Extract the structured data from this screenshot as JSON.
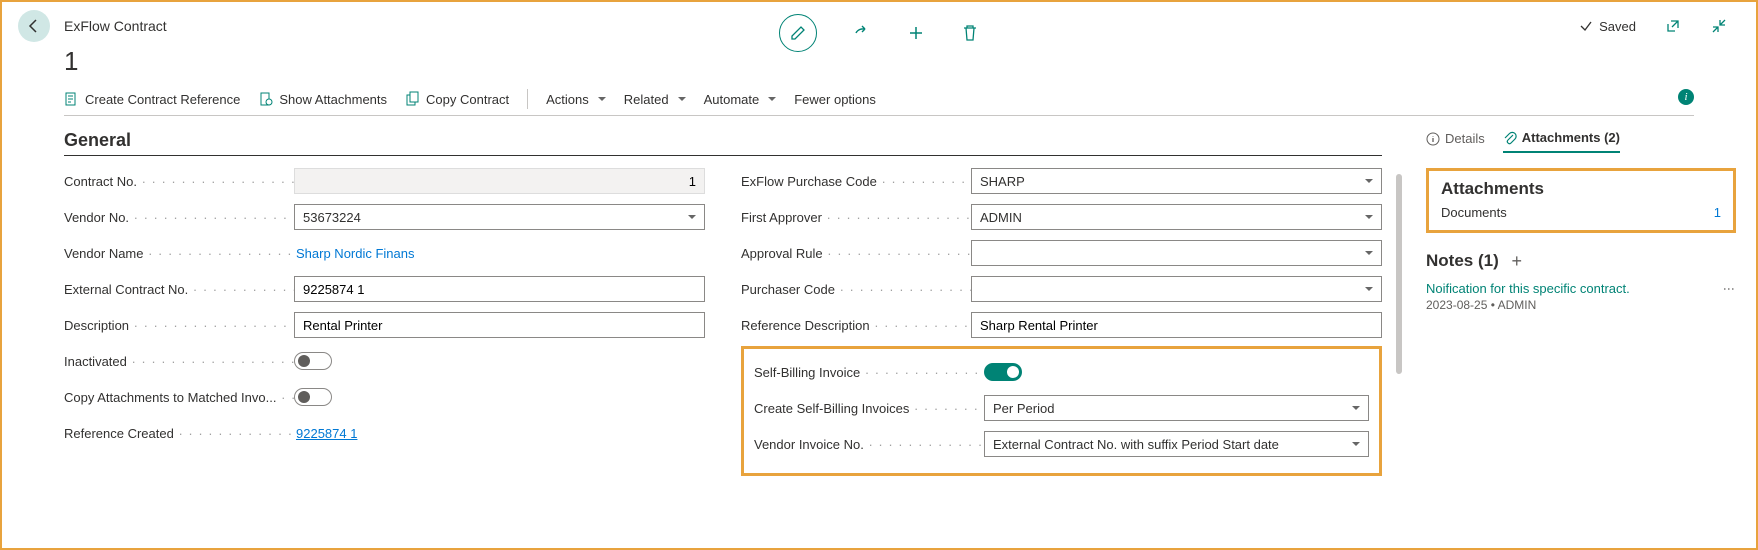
{
  "header": {
    "page_type": "ExFlow Contract",
    "entity_id": "1",
    "saved": "Saved"
  },
  "toolbar": {
    "create_ref": "Create Contract Reference",
    "show_attach": "Show Attachments",
    "copy_contract": "Copy Contract",
    "actions": "Actions",
    "related": "Related",
    "automate": "Automate",
    "fewer": "Fewer options"
  },
  "section": {
    "general": "General"
  },
  "fields": {
    "contract_no": {
      "label": "Contract No.",
      "value": "1"
    },
    "vendor_no": {
      "label": "Vendor No.",
      "value": "53673224"
    },
    "vendor_name": {
      "label": "Vendor Name",
      "value": "Sharp Nordic Finans"
    },
    "ext_contract_no": {
      "label": "External Contract No.",
      "value": "9225874 1"
    },
    "description": {
      "label": "Description",
      "value": "Rental Printer"
    },
    "inactivated": {
      "label": "Inactivated"
    },
    "copy_attach": {
      "label": "Copy Attachments to Matched Invo..."
    },
    "ref_created": {
      "label": "Reference Created",
      "value": "9225874 1"
    },
    "purchase_code": {
      "label": "ExFlow Purchase Code",
      "value": "SHARP"
    },
    "first_approver": {
      "label": "First Approver",
      "value": "ADMIN"
    },
    "approval_rule": {
      "label": "Approval Rule",
      "value": ""
    },
    "purchaser_code": {
      "label": "Purchaser Code",
      "value": ""
    },
    "ref_desc": {
      "label": "Reference Description",
      "value": "Sharp Rental Printer"
    },
    "self_billing": {
      "label": "Self-Billing Invoice"
    },
    "create_sbi": {
      "label": "Create Self-Billing Invoices",
      "value": "Per Period"
    },
    "vendor_inv_no": {
      "label": "Vendor Invoice No.",
      "value": "External Contract No. with suffix Period Start date"
    }
  },
  "side": {
    "tab_details": "Details",
    "tab_attachments": "Attachments (2)",
    "attach_heading": "Attachments",
    "documents_label": "Documents",
    "documents_count": "1",
    "notes_heading": "Notes (1)",
    "note_text": "Noification for this specific contract.",
    "note_meta": "2023-08-25 • ADMIN"
  }
}
